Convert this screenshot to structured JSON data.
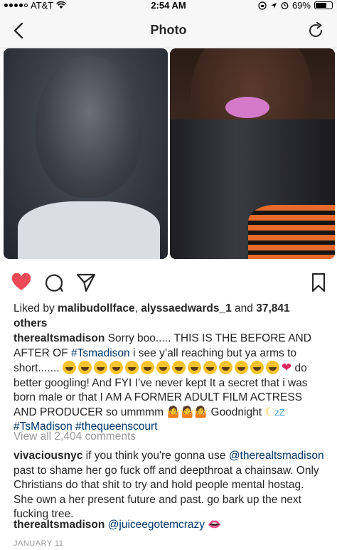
{
  "status_bar": {
    "carrier": "AT&T",
    "time": "2:54 AM",
    "battery": "69%",
    "battery_level": 0.69
  },
  "navbar": {
    "title": "Photo"
  },
  "post": {
    "liked_by_prefix": "Liked by ",
    "liked_user_1": "malibudollface",
    "liked_sep": ", ",
    "liked_user_2": "alyssaedwards_1",
    "liked_and": " and ",
    "liked_others": "37,841 others",
    "caption_user": "therealtsmadison",
    "caption_1": " Sorry boo..... THIS IS THE BEFORE AND AFTER OF ",
    "caption_tag_1": "#Tsmadison",
    "caption_2": " i see y’all reaching but ya arms to short.......",
    "caption_3": " do better googling! And FYI I’ve never kept It a secret that i was born male or that I AM A FORMER ADULT FILM ACTRESS AND PRODUCER so ummmm",
    "caption_4": " Goodnight",
    "caption_tag_2": "#TsMadison",
    "caption_tag_3": "#thequeenscourt",
    "view_all_comments": "View all 2,404 comments",
    "comments": [
      {
        "user": "vivaciousnyc",
        "text_1": " if you think you're gonna use ",
        "mention": "@therealtsmadison",
        "text_2": "  past to shame her go fuck off and deepthroat a chainsaw. Only Christians do that shit to try and hold people mental hostag. She own a her present future and past. go bark up the next fucking tree."
      },
      {
        "user": "therealtsmadison",
        "mention": "@juiceegotemcrazy"
      }
    ],
    "date": "JANUARY 11"
  },
  "icons": {
    "back": "chevron-left-icon",
    "refresh": "refresh-icon",
    "like": "heart-icon",
    "comment": "comment-bubble-icon",
    "share": "paper-plane-icon",
    "save": "bookmark-icon"
  },
  "colors": {
    "like_red": "#ed4956",
    "link_blue": "#003569",
    "muted_gray": "#999999"
  }
}
